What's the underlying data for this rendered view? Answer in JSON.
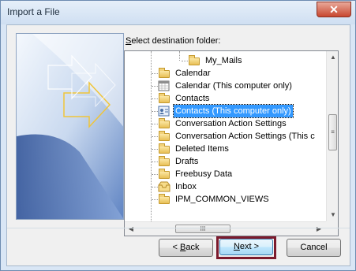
{
  "window": {
    "title": "Import a File",
    "close_glyph": "✕"
  },
  "prompt": {
    "prefix": "S",
    "rest": "elect destination folder:"
  },
  "tree": {
    "items": [
      {
        "label": "My_Mails",
        "icon": "folder-icon"
      },
      {
        "label": "Calendar",
        "icon": "folder-icon"
      },
      {
        "label": "Calendar (This computer only)",
        "icon": "calendar-icon"
      },
      {
        "label": "Contacts",
        "icon": "folder-icon"
      },
      {
        "label": "Contacts (This computer only)",
        "icon": "contact-card-icon",
        "selected": true
      },
      {
        "label": "Conversation Action Settings",
        "icon": "folder-icon"
      },
      {
        "label": "Conversation Action Settings (This c",
        "icon": "folder-icon"
      },
      {
        "label": "Deleted Items",
        "icon": "folder-icon"
      },
      {
        "label": "Drafts",
        "icon": "folder-icon"
      },
      {
        "label": "Freebusy Data",
        "icon": "folder-icon"
      },
      {
        "label": "Inbox",
        "icon": "inbox-icon"
      },
      {
        "label": "IPM_COMMON_VIEWS",
        "icon": "folder-icon"
      }
    ]
  },
  "scrollbar": {
    "up": "▲",
    "down": "▼",
    "left": "◀",
    "right": "▶",
    "grip_v": "≡",
    "grip_h": "III"
  },
  "buttons": {
    "back": {
      "accel": "B",
      "text": "ack",
      "arrow": "< "
    },
    "next": {
      "accel": "N",
      "text": "ext",
      "arrow": " >"
    },
    "cancel": "Cancel"
  }
}
